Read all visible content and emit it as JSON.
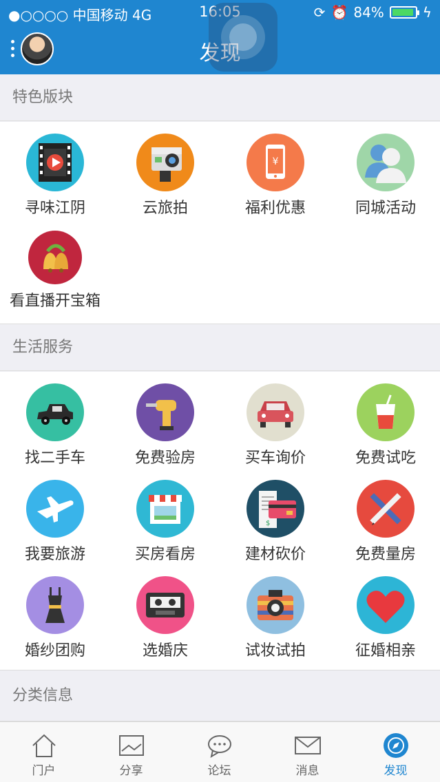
{
  "status_bar": {
    "carrier": "●○○○○ 中国移动  4G",
    "time": "16:05",
    "battery": "84%"
  },
  "header": {
    "title": "发现"
  },
  "sections": [
    {
      "title": "特色版块",
      "items": [
        {
          "label": "寻味江阴",
          "icon": "film-icon",
          "color": "#2ab7d6"
        },
        {
          "label": "云旅拍",
          "icon": "action-camera-icon",
          "color": "#f08a1a"
        },
        {
          "label": "福利优惠",
          "icon": "phone-yuan-icon",
          "color": "#f47a4a"
        },
        {
          "label": "同城活动",
          "icon": "people-icon",
          "color": "#9fd6a8"
        },
        {
          "label": "看直播开宝箱",
          "icon": "bells-icon",
          "color": "#c0263e"
        }
      ]
    },
    {
      "title": "生活服务",
      "items": [
        {
          "label": "找二手车",
          "icon": "vintage-car-icon",
          "color": "#36bfa2"
        },
        {
          "label": "免费验房",
          "icon": "drill-icon",
          "color": "#6f4fa6"
        },
        {
          "label": "买车询价",
          "icon": "car-icon",
          "color": "#e1dfcf"
        },
        {
          "label": "免费试吃",
          "icon": "drink-icon",
          "color": "#9cd25e"
        },
        {
          "label": "我要旅游",
          "icon": "airplane-icon",
          "color": "#39b4ea"
        },
        {
          "label": "买房看房",
          "icon": "shop-icon",
          "color": "#2fb8d4"
        },
        {
          "label": "建材砍价",
          "icon": "card-receipt-icon",
          "color": "#1f4f66"
        },
        {
          "label": "免费量房",
          "icon": "ruler-pencil-icon",
          "color": "#e64a3e"
        },
        {
          "label": "婚纱团购",
          "icon": "dress-icon",
          "color": "#a48ee3"
        },
        {
          "label": "选婚庆",
          "icon": "cassette-icon",
          "color": "#f05288"
        },
        {
          "label": "试妆试拍",
          "icon": "camera-icon",
          "color": "#8fbfe0"
        },
        {
          "label": "征婚相亲",
          "icon": "heart-icon",
          "color": "#2db5d6"
        }
      ]
    },
    {
      "title": "分类信息",
      "items": []
    }
  ],
  "tabs": [
    {
      "label": "门户",
      "icon": "home-icon"
    },
    {
      "label": "分享",
      "icon": "image-icon"
    },
    {
      "label": "论坛",
      "icon": "chat-icon"
    },
    {
      "label": "消息",
      "icon": "mail-icon"
    },
    {
      "label": "发现",
      "icon": "compass-icon",
      "active": true
    }
  ]
}
